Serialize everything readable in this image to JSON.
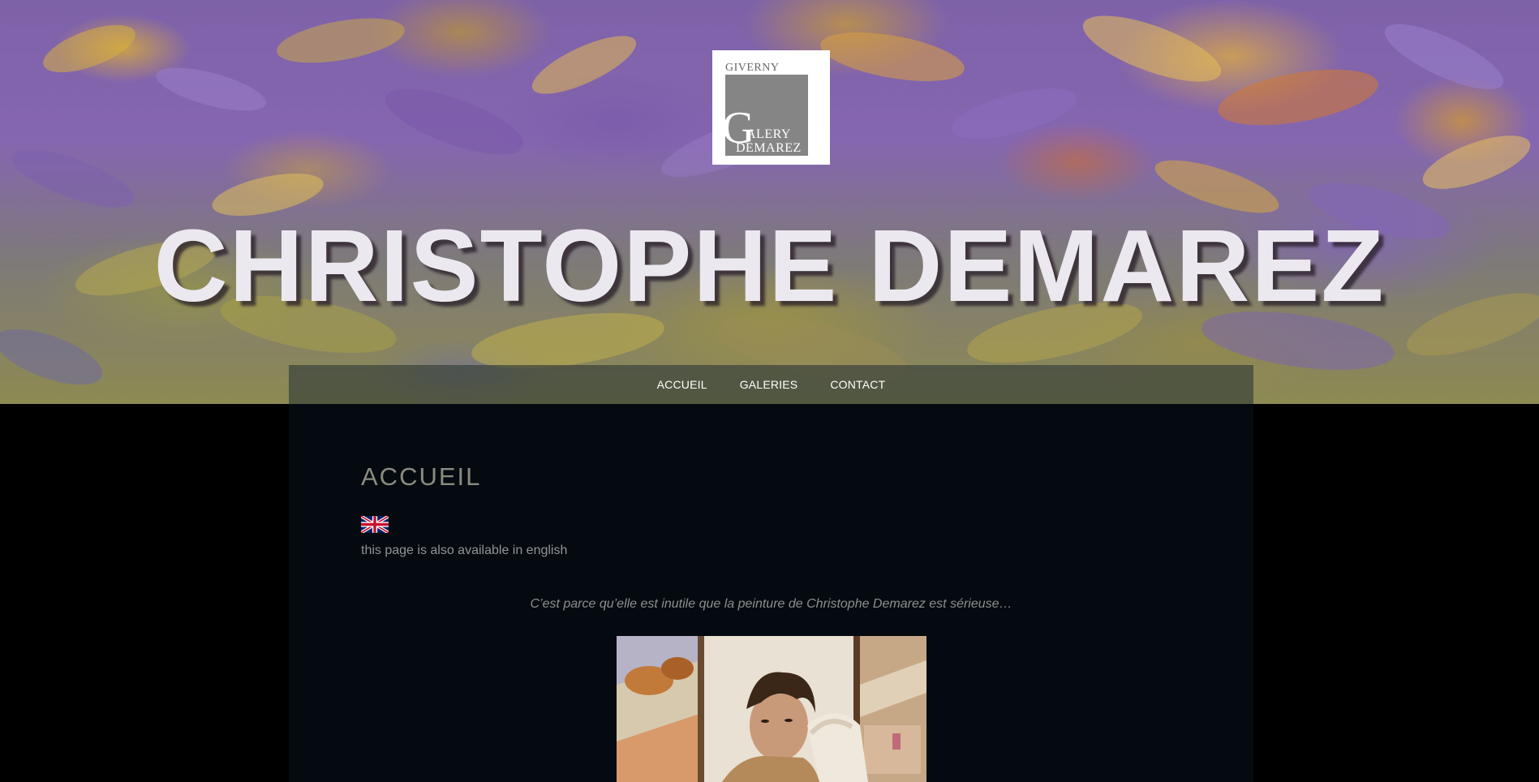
{
  "logo": {
    "line1": "GIVERNY",
    "initial": "G",
    "line2": "ALERY",
    "line3": "DEMAREZ"
  },
  "site_title": "CHRISTOPHE DEMAREZ",
  "nav": {
    "items": [
      {
        "label": "ACCUEIL"
      },
      {
        "label": "GALERIES"
      },
      {
        "label": "CONTACT"
      }
    ]
  },
  "page": {
    "heading": "ACCUEIL",
    "english_link": "this page is also available in english",
    "quote": "C’est parce qu’elle est inutile que la peinture de Christophe Demarez est sérieuse…"
  },
  "colors": {
    "content_bg": "#040a10",
    "nav_bg": "#3c443c",
    "heading": "#8b8b80",
    "text": "#939393"
  },
  "icons": {
    "flag": "uk-flag-icon"
  }
}
